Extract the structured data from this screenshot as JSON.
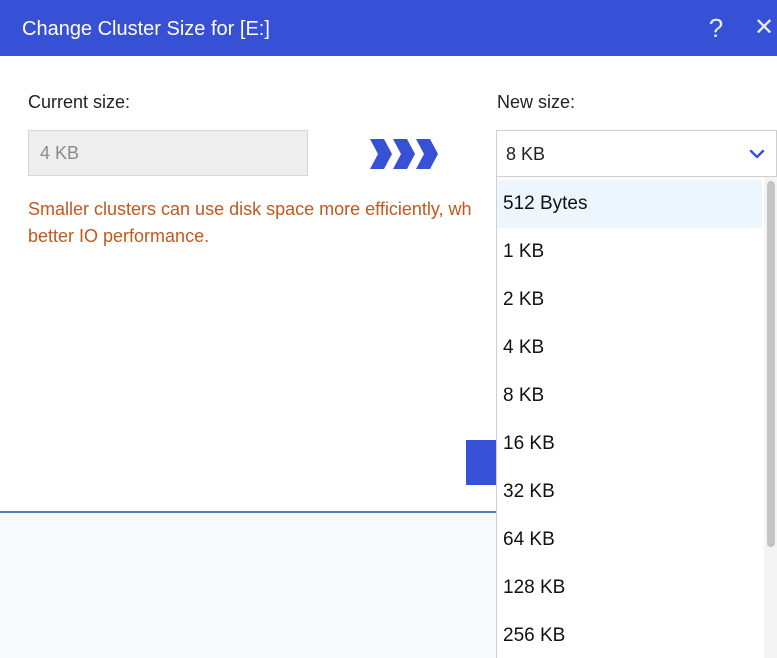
{
  "dialog": {
    "title": "Change Cluster Size for [E:]",
    "help_glyph": "?",
    "close_glyph": "✕"
  },
  "current": {
    "label": "Current size:",
    "value": "4 KB"
  },
  "new_size": {
    "label": "New size:",
    "selected_value": "8 KB",
    "options": [
      "512 Bytes",
      "1 KB",
      "2 KB",
      "4 KB",
      "8 KB",
      "16 KB",
      "32 KB",
      "64 KB",
      "128 KB",
      "256 KB"
    ],
    "highlighted_option": "512 Bytes"
  },
  "hint": {
    "line1": "Smaller clusters can use disk space more efficiently, wh",
    "line2": "better IO performance."
  },
  "icons": {
    "arrows": "triple-chevron-right-icon",
    "dropdown": "chevron-down-icon",
    "help": "help-icon",
    "close": "close-icon"
  },
  "colors": {
    "title_bar": "#3651d6",
    "accent": "#3651d6",
    "hint_text": "#c2581d",
    "option_highlight": "#edf6fd"
  }
}
